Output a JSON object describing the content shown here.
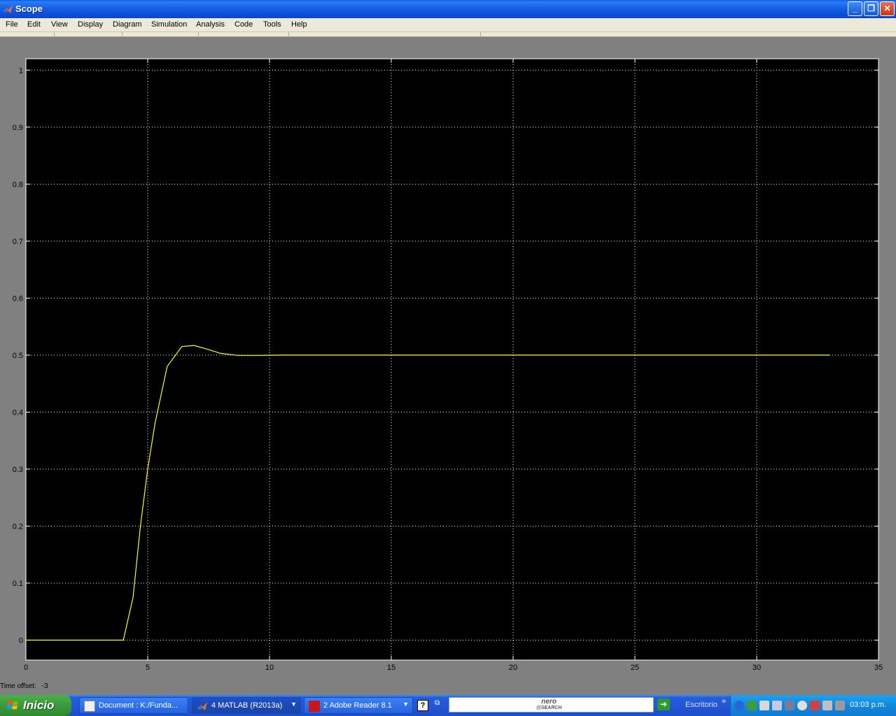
{
  "window": {
    "title": "Scope",
    "menu": [
      "File",
      "Edit",
      "View",
      "Display",
      "Diagram",
      "Simulation",
      "Analysis",
      "Code",
      "Tools",
      "Help"
    ]
  },
  "status": {
    "time_offset_label": "Time offset:",
    "time_offset_value": "-3"
  },
  "chart_data": {
    "type": "line",
    "title": "",
    "xlabel": "",
    "ylabel": "",
    "xlim": [
      0,
      35
    ],
    "ylim": [
      -0.035,
      1.02
    ],
    "x_ticks": [
      0,
      5,
      10,
      15,
      20,
      25,
      30,
      35
    ],
    "y_ticks": [
      0,
      0.1,
      0.2,
      0.3,
      0.4,
      0.5,
      0.6,
      0.7,
      0.8,
      0.9,
      1
    ],
    "grid": true,
    "background": "#000000",
    "series": [
      {
        "color": "#ffff00",
        "x": [
          0,
          4.0,
          4.4,
          4.7,
          5.0,
          5.3,
          5.8,
          6.4,
          6.9,
          7.4,
          8.0,
          8.7,
          9.5,
          10.5,
          33.0
        ],
        "y": [
          0,
          0,
          0.075,
          0.2,
          0.3,
          0.38,
          0.48,
          0.515,
          0.517,
          0.511,
          0.503,
          0.4995,
          0.4995,
          0.5,
          0.5
        ]
      }
    ]
  },
  "taskbar": {
    "start_label": "Inicio",
    "tasks": [
      {
        "label": "Document : K:/Funda..."
      },
      {
        "label": "4 MATLAB (R2013a)"
      },
      {
        "label": "2 Adobe Reader 8.1"
      }
    ],
    "search_brand": "nero",
    "search_brand_sub": "@SEARCH",
    "desktop_label": "Escritorio",
    "clock": "03:03 p.m."
  },
  "colors": {
    "plot_background": "#000000",
    "grid": "#ffffff",
    "trace": "#ffff00",
    "figure_background": "#808080"
  }
}
